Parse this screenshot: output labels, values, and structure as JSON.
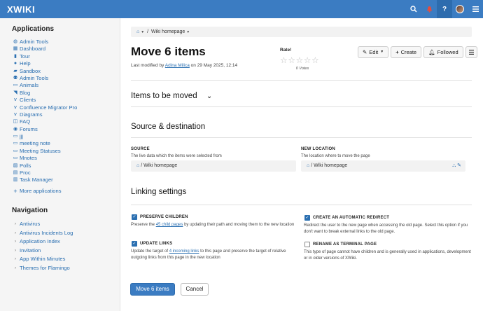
{
  "header": {
    "logo": "XWIKI",
    "icons": [
      "search-icon",
      "bell-icon",
      "help-icon",
      "avatar",
      "menu-icon"
    ],
    "help_label": "?",
    "accent": "#3b7cc2"
  },
  "sidebar": {
    "applications_title": "Applications",
    "applications": [
      {
        "label": "Admin Tools",
        "icon": "globe-icon"
      },
      {
        "label": "Dashboard",
        "icon": "dashboard-icon"
      },
      {
        "label": "Tour",
        "icon": "tour-icon"
      },
      {
        "label": "Help",
        "icon": "help-icon"
      },
      {
        "label": "Sandbox",
        "icon": "sandbox-icon"
      },
      {
        "label": "Admin Tools",
        "icon": "people-icon"
      },
      {
        "label": "Animals",
        "icon": "page-icon"
      },
      {
        "label": "Blog",
        "icon": "rss-icon"
      },
      {
        "label": "Clients",
        "icon": "branch-icon"
      },
      {
        "label": "Confluence Migrator Pro",
        "icon": "branch-icon"
      },
      {
        "label": "Diagrams",
        "icon": "branch-icon"
      },
      {
        "label": "FAQ",
        "icon": "faq-icon"
      },
      {
        "label": "Forums",
        "icon": "forum-icon"
      },
      {
        "label": "jjj",
        "icon": "page-icon"
      },
      {
        "label": "meeting note",
        "icon": "page-icon"
      },
      {
        "label": "Meeting Statuses",
        "icon": "page-icon"
      },
      {
        "label": "Mnotes",
        "icon": "page-icon"
      },
      {
        "label": "Polls",
        "icon": "poll-icon"
      },
      {
        "label": "Proc",
        "icon": "document-icon"
      },
      {
        "label": "Task Manager",
        "icon": "task-icon"
      }
    ],
    "more_label": "More applications",
    "navigation_title": "Navigation",
    "navigation": [
      {
        "label": "Antivirus"
      },
      {
        "label": "Antivirus Incidents Log"
      },
      {
        "label": "Application Index"
      },
      {
        "label": "Invitation"
      },
      {
        "label": "App Within Minutes"
      },
      {
        "label": "Themes for Flamingo"
      }
    ]
  },
  "main": {
    "breadcrumb_current": "Wiki homepage",
    "title": "Move 6 items",
    "modified_prefix": "Last modified by",
    "modified_user": "Adina Milica",
    "modified_suffix": "on 29 May 2025, 12:14",
    "rate_label": "Rate!",
    "stars": "☆☆☆☆☆",
    "votes": "0 Votes",
    "edit_label": "Edit",
    "create_label": "Create",
    "followed_label": "Followed",
    "items_section": "Items to be moved",
    "source_section": "Source & destination",
    "source_label": "SOURCE",
    "source_hint": "The live data which the items were selected from",
    "source_value": "Wiki homepage",
    "new_location_label": "NEW LOCATION",
    "new_location_hint": "The location where to move the page",
    "new_location_value": "Wiki homepage",
    "linking_section": "Linking settings",
    "preserve_children_label": "PRESERVE CHILDREN",
    "preserve_children_desc_pre": "Preserve the",
    "preserve_children_link": "45 child pages",
    "preserve_children_desc_post": "by updating their path and moving them to the new location",
    "preserve_children_checked": true,
    "update_links_label": "UPDATE LINKS",
    "update_links_desc_pre": "Update the target of",
    "update_links_link": "4 incoming links",
    "update_links_desc_post": "to this page and preserve the target of relative outgoing links from this page in the new location",
    "update_links_checked": true,
    "redirect_label": "CREATE AN AUTOMATIC REDIRECT",
    "redirect_desc": "Redirect the user to the new page when accessing the old page. Select this option if you don't want to break external links to the old page.",
    "redirect_checked": true,
    "terminal_label": "RENAME AS TERMINAL PAGE",
    "terminal_desc": "This type of page cannot have children and is generally used in applications, development or in older versions of XWiki.",
    "terminal_checked": false,
    "submit_label": "Move 6 items",
    "cancel_label": "Cancel"
  }
}
